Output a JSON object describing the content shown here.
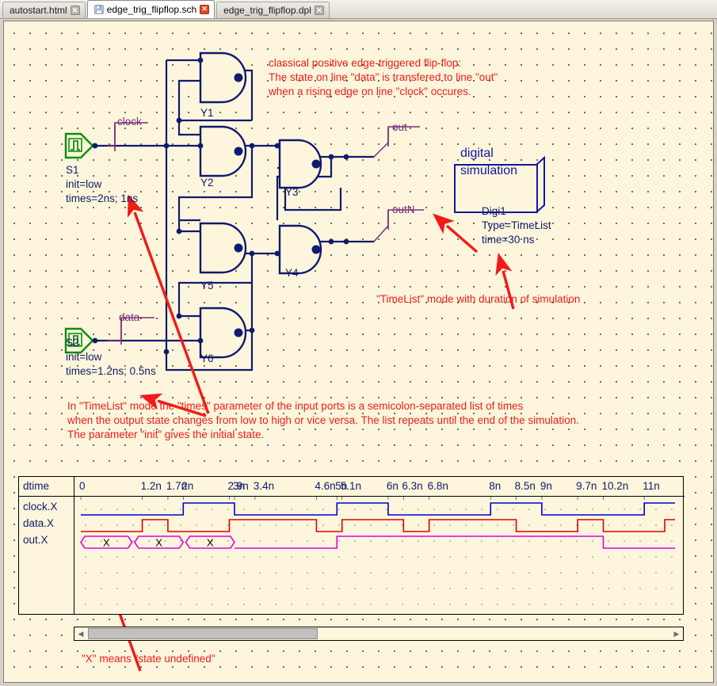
{
  "tabs": [
    {
      "label": "autostart.html",
      "active": false,
      "has_save_icon": false
    },
    {
      "label": "edge_trig_flipflop.sch",
      "active": true,
      "has_save_icon": true
    },
    {
      "label": "edge_trig_flipflop.dpl",
      "active": false,
      "has_save_icon": false
    }
  ],
  "colors": {
    "canvas_bg": "#fdf6dc",
    "wire": "#101a6e",
    "annotation_red": "#f21a1a",
    "label_purple": "#7d2a7d",
    "source_green": "#0a8f0a",
    "clock_trace": "#0000d0",
    "data_trace": "#e00000",
    "out_trace": "#e000e0"
  },
  "annotations": {
    "title_note": [
      "classical positive edge-triggered flip-flop:",
      "The state on line \"data\" is transfered to line \"out\"",
      "when a rising edge on line \"clock\" occures."
    ],
    "timelist_note": "\"TimeList\" mode with duration of simulation",
    "times_note": [
      "In \"TimeList\" mode the \"times\" parameter of the input ports is a semicolon-separated list of times",
      "when the output state changes from low to high or vice versa. The list repeats until the end of the simulation.",
      "The parameter \"init\" gives the initial state."
    ],
    "x_note": "\"X\" means \"state undefined\""
  },
  "circuit": {
    "gates": [
      {
        "name": "Y1"
      },
      {
        "name": "Y2"
      },
      {
        "name": "Y3"
      },
      {
        "name": "Y4"
      },
      {
        "name": "Y5"
      },
      {
        "name": "Y6"
      }
    ],
    "wire_labels": [
      {
        "name": "clock"
      },
      {
        "name": "data"
      },
      {
        "name": "out"
      },
      {
        "name": "outN"
      }
    ],
    "sources": [
      {
        "id": "S1",
        "init": "init=low",
        "times": "times=2ns; 1ns"
      },
      {
        "id": "S2",
        "init": "init=low",
        "times": "times=1.2ns; 0.5ns"
      }
    ],
    "sim_block": {
      "line1": "digital",
      "line2": "simulation",
      "id": "Digi1",
      "type": "Type=TimeList",
      "time": "time=30 ns"
    }
  },
  "waveform": {
    "header_label": "dtime",
    "rows": [
      {
        "label": "clock.X"
      },
      {
        "label": "data.X"
      },
      {
        "label": "out.X"
      }
    ],
    "undefined_markers": [
      "X",
      "X",
      "X"
    ],
    "ticks": [
      "0",
      "1.2n",
      "1.7n",
      "2n",
      "2.9n",
      "3n",
      "3.4n",
      "4.6n",
      "5n",
      "5.1n",
      "6n",
      "6.3n",
      "6.8n",
      "8n",
      "8.5n",
      "9n",
      "9.7n",
      "10.2n",
      "11n"
    ]
  },
  "chart_data": {
    "type": "line",
    "title": "dtime",
    "xlabel": "dtime",
    "ylabel": "",
    "xlim": [
      0,
      11.6
    ],
    "grid": true,
    "legend": "none",
    "x_ticks": [
      0,
      1.2,
      1.7,
      2,
      2.9,
      3,
      3.4,
      4.6,
      5,
      5.1,
      6,
      6.3,
      6.8,
      8,
      8.5,
      9,
      9.7,
      10.2,
      11
    ],
    "x_tick_labels": [
      "0",
      "1.2n",
      "1.7n",
      "2n",
      "2.9n",
      "3n",
      "3.4n",
      "4.6n",
      "5n",
      "5.1n",
      "6n",
      "6.3n",
      "6.8n",
      "8n",
      "8.5n",
      "9n",
      "9.7n",
      "10.2n",
      "11n"
    ],
    "series": [
      {
        "name": "clock.X",
        "color": "#0000d0",
        "kind": "digital",
        "transitions": [
          {
            "t": 0.0,
            "v": 0
          },
          {
            "t": 2.0,
            "v": 1
          },
          {
            "t": 3.0,
            "v": 0
          },
          {
            "t": 5.0,
            "v": 1
          },
          {
            "t": 6.0,
            "v": 0
          },
          {
            "t": 8.0,
            "v": 1
          },
          {
            "t": 9.0,
            "v": 0
          },
          {
            "t": 11.0,
            "v": 1
          }
        ]
      },
      {
        "name": "data.X",
        "color": "#e00000",
        "kind": "digital",
        "transitions": [
          {
            "t": 0.0,
            "v": 0
          },
          {
            "t": 1.2,
            "v": 1
          },
          {
            "t": 1.7,
            "v": 0
          },
          {
            "t": 2.9,
            "v": 1
          },
          {
            "t": 4.6,
            "v": 0
          },
          {
            "t": 5.1,
            "v": 1
          },
          {
            "t": 6.3,
            "v": 0
          },
          {
            "t": 6.8,
            "v": 1
          },
          {
            "t": 8.5,
            "v": 0
          },
          {
            "t": 9.7,
            "v": 1
          },
          {
            "t": 10.2,
            "v": 0
          },
          {
            "t": 11.4,
            "v": 1
          }
        ]
      },
      {
        "name": "out.X",
        "color": "#e000e0",
        "kind": "digital",
        "undefined_until": 3.0,
        "undefined_segments": [
          {
            "start": 0.0,
            "end": 1.0,
            "label": "X"
          },
          {
            "start": 1.05,
            "end": 2.0,
            "label": "X"
          },
          {
            "start": 2.05,
            "end": 3.0,
            "label": "X"
          }
        ],
        "transitions": [
          {
            "t": 3.0,
            "v": 0
          },
          {
            "t": 5.0,
            "v": 1
          },
          {
            "t": 10.2,
            "v": 0
          }
        ]
      }
    ]
  }
}
